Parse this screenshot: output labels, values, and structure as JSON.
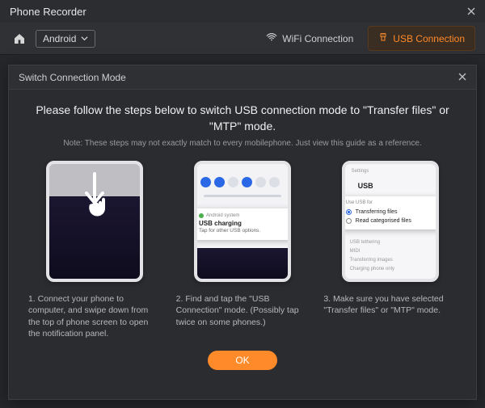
{
  "app": {
    "title": "Phone Recorder"
  },
  "toolbar": {
    "os_selected": "Android",
    "wifi_label": "WiFi Connection",
    "usb_label": "USB Connection"
  },
  "modal": {
    "title": "Switch Connection Mode",
    "headline": "Please follow the steps below to switch USB connection mode to \"Transfer files\" or \"MTP\" mode.",
    "note": "Note: These steps may not exactly match to every mobilephone. Just view this guide as a reference.",
    "ok_label": "OK",
    "steps": [
      {
        "text": "1. Connect your phone to computer, and swipe down from the top of phone screen to open the notification panel."
      },
      {
        "text": "2. Find and tap the \"USB Connection\" mode. (Possibly tap twice on some phones.)",
        "toast": {
          "system_label": "Android system",
          "title": "USB charging",
          "subtitle": "Tap for other USB options."
        }
      },
      {
        "text": "3. Make sure you have selected \"Transfer files\" or \"MTP\" mode.",
        "settings": {
          "back_label": "Settings",
          "title": "USB",
          "group_label": "Use USB for",
          "options": [
            {
              "label": "Transferring files",
              "selected": true
            },
            {
              "label": "Read categorised files",
              "selected": false
            }
          ],
          "other_items": [
            "USB tethering",
            "MIDI",
            "Transferring images",
            "Charging phone only"
          ]
        }
      }
    ]
  }
}
